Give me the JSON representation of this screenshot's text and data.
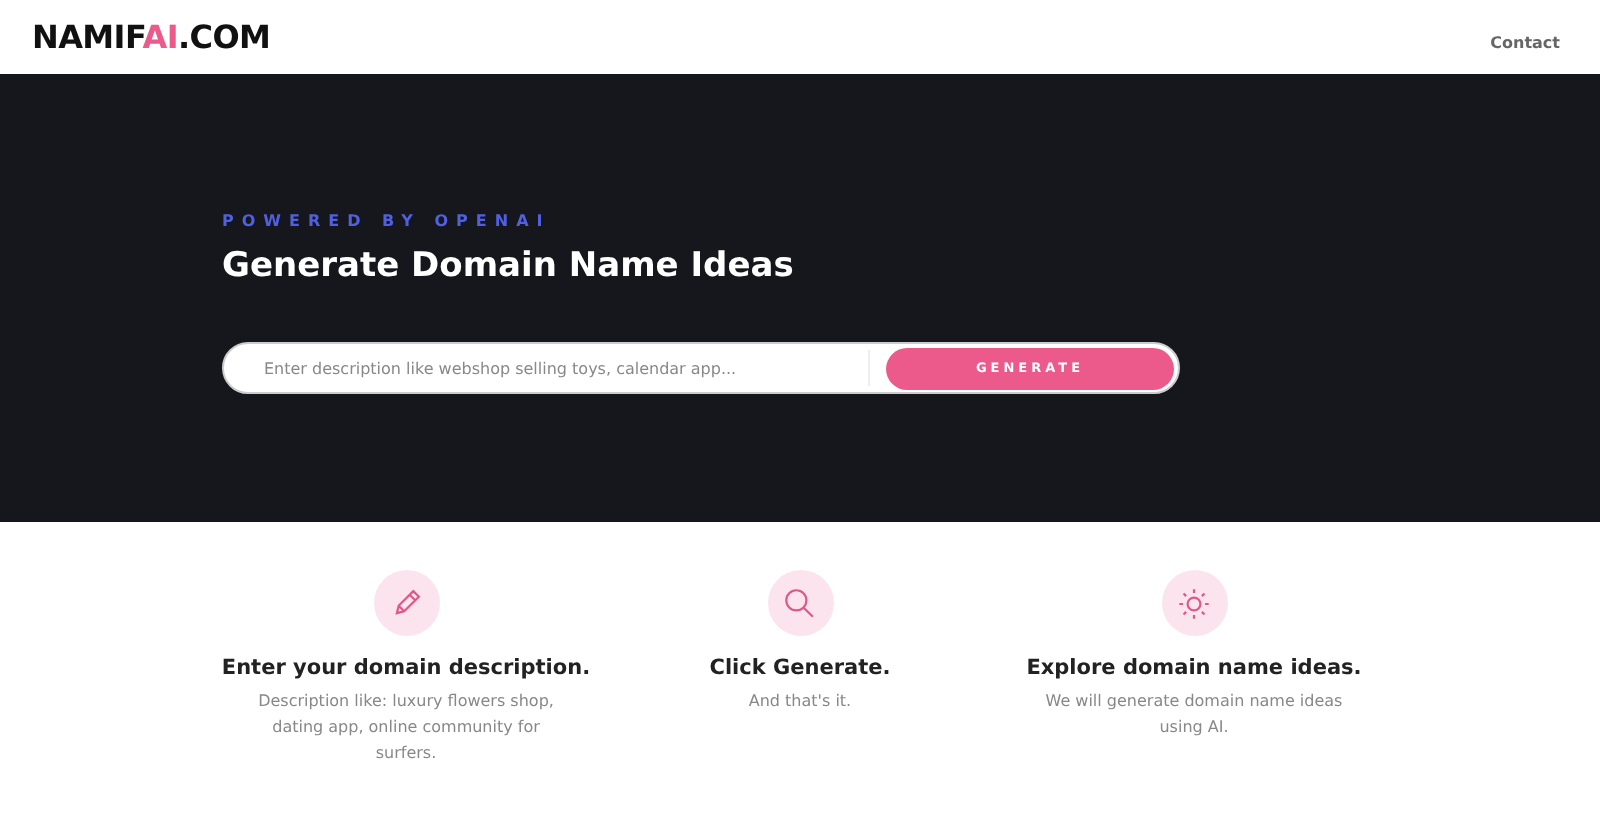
{
  "logo": [
    {
      "text": "NAMIF",
      "accent": false
    },
    {
      "text": "AI",
      "accent": true
    },
    {
      "text": ".COM",
      "accent": false
    }
  ],
  "nav": [
    "Contact"
  ],
  "hero": {
    "eyebrow": "POWERED BY OPENAI",
    "title": "Generate Domain Name Ideas",
    "search": {
      "placeholder": "Enter description like webshop selling toys, calendar app..."
    },
    "button": "GENERATE"
  },
  "steps": [
    {
      "kind": "pencil",
      "title": "Enter your domain description.",
      "text": "Description like: luxury flowers shop, dating app, online community for surfers."
    },
    {
      "kind": "search",
      "title": "Click Generate.",
      "text": "And that's it."
    },
    {
      "kind": "sun",
      "title": "Explore domain name ideas.",
      "text": "We will generate domain name ideas using AI."
    }
  ]
}
